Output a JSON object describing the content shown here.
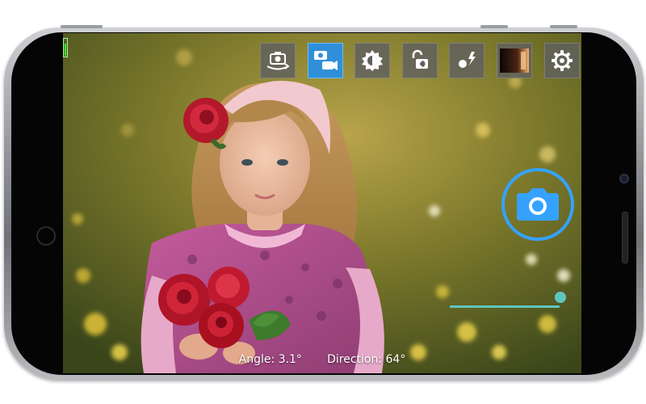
{
  "toolbar": {
    "items": [
      {
        "icon": "switch-camera-icon",
        "active": false
      },
      {
        "icon": "photo-video-mode-icon",
        "active": true
      },
      {
        "icon": "exposure-icon",
        "active": false
      },
      {
        "icon": "exposure-lock-icon",
        "active": false
      },
      {
        "icon": "flash-icon",
        "active": false
      },
      {
        "icon": "gallery-thumbnail-icon",
        "active": false
      },
      {
        "icon": "settings-icon",
        "active": false
      }
    ],
    "active_color": "#2f8fd8"
  },
  "battery": {
    "level": 0.7,
    "color": "#39e639"
  },
  "shutter": {
    "icon": "camera-icon",
    "color": "#35a2ff"
  },
  "zoom": {
    "level": 0.95,
    "color": "#5ec5bd"
  },
  "status": {
    "angle_label": "Angle: 3.1°",
    "direction_label": "Direction: 64°"
  }
}
